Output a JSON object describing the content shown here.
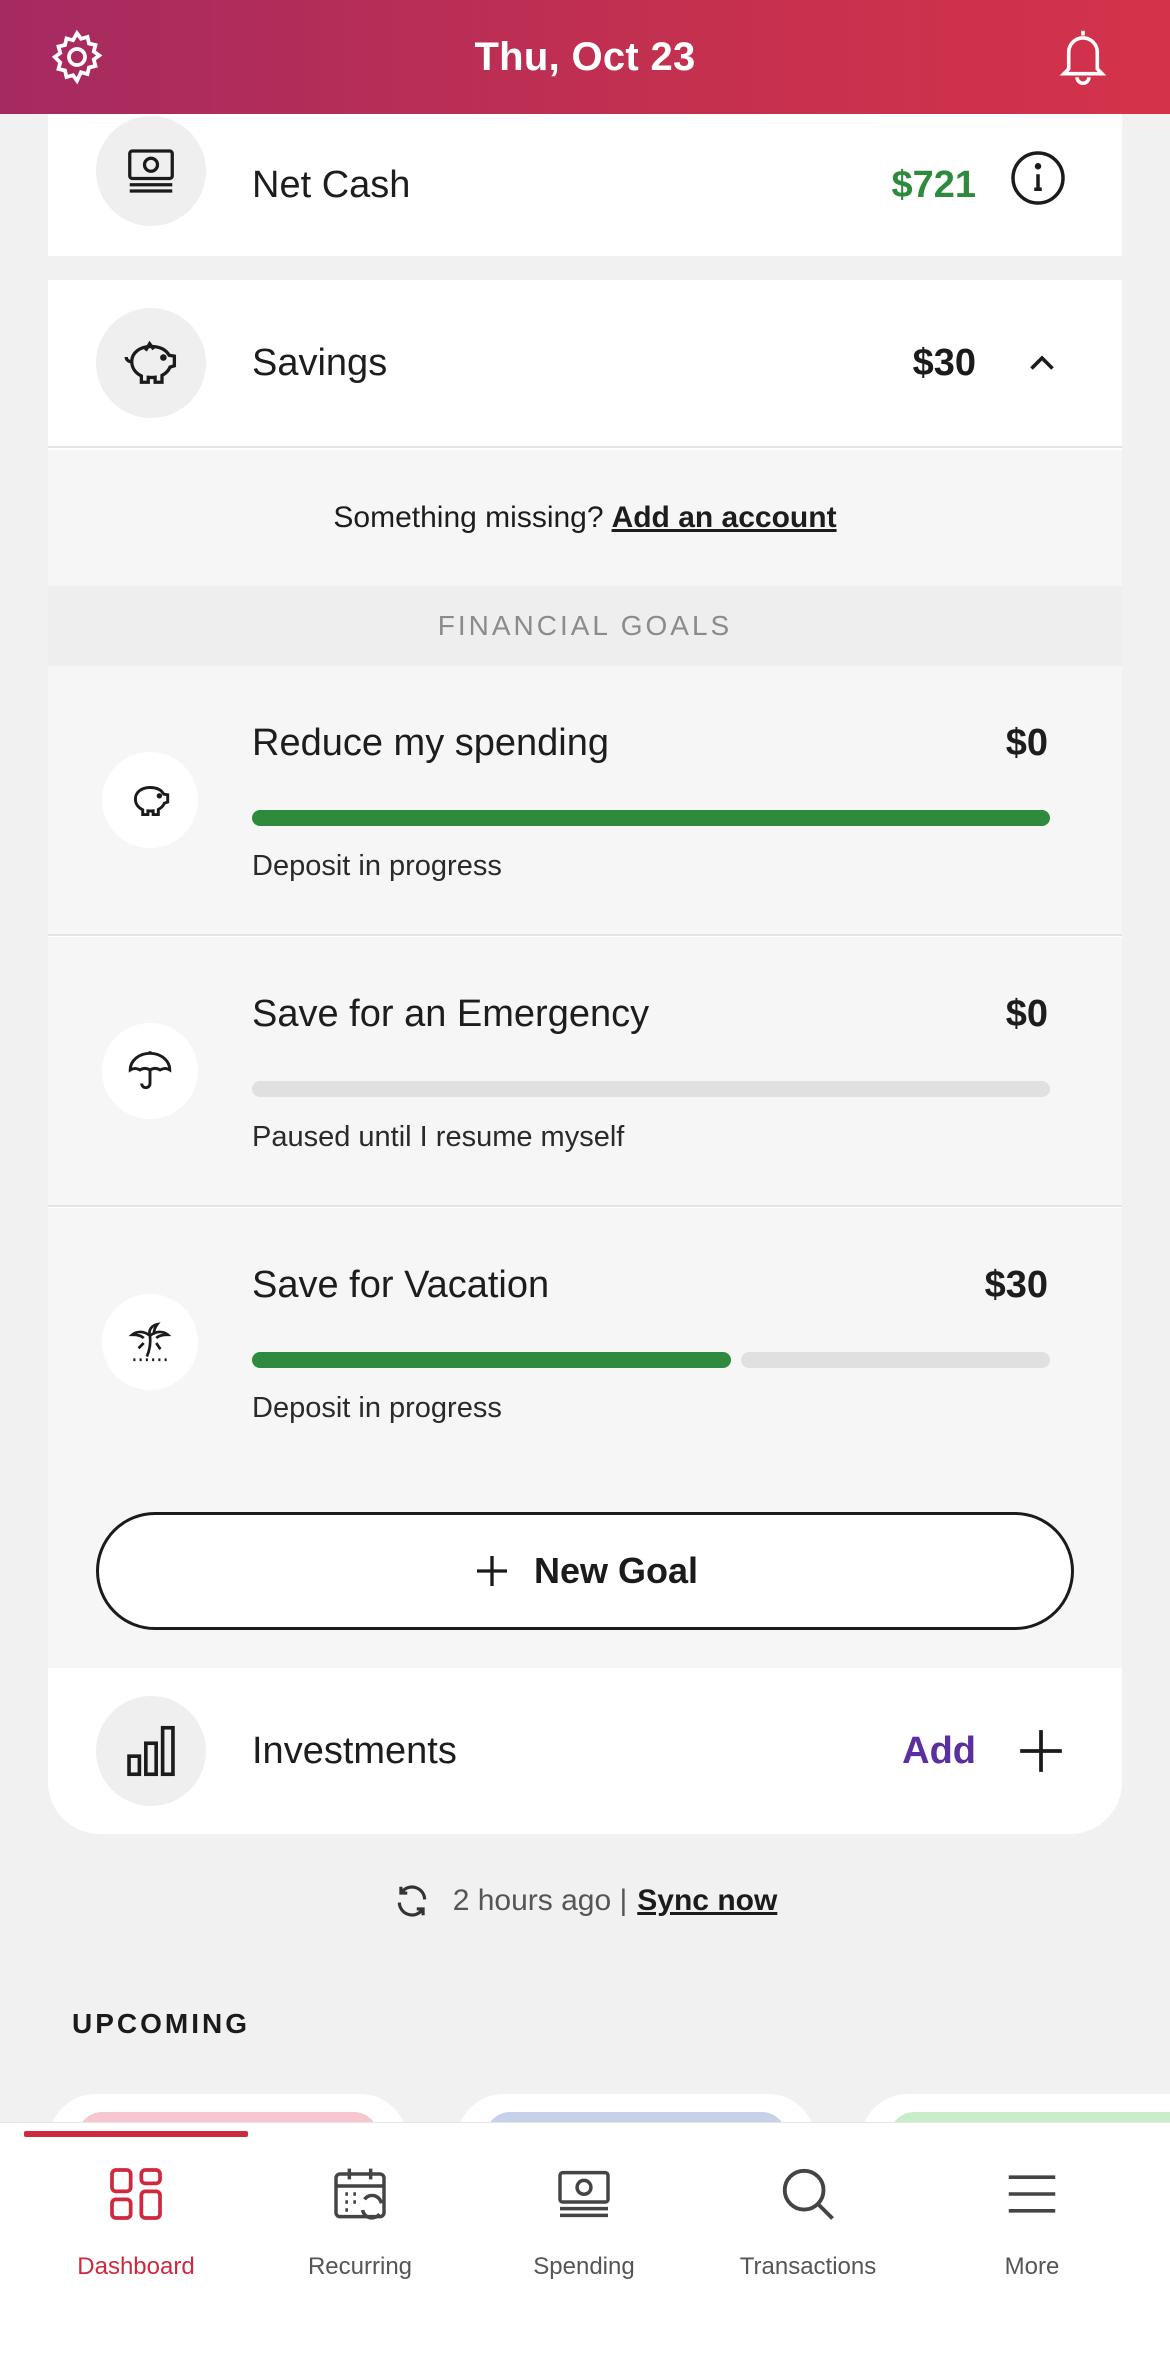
{
  "header": {
    "date": "Thu, Oct 23",
    "settings_icon": "gear-icon",
    "notifications_icon": "bell-icon"
  },
  "accounts": {
    "net_cash": {
      "label": "Net Cash",
      "value": "$721",
      "icon": "cash-icon",
      "info_icon": "info-icon"
    },
    "savings": {
      "label": "Savings",
      "value": "$30",
      "icon": "piggy-bank-icon",
      "toggle_icon": "chevron-up-icon"
    },
    "missing": {
      "prompt": "Something missing?",
      "link": "Add an account"
    }
  },
  "financial_goals": {
    "heading": "FINANCIAL GOALS",
    "goals": [
      {
        "title": "Reduce my spending",
        "amount": "$0",
        "status": "Deposit in progress",
        "progress": 1.0,
        "icon": "piggy-bank-icon"
      },
      {
        "title": "Save for an Emergency",
        "amount": "$0",
        "status": "Paused until I resume myself",
        "progress": 0.0,
        "icon": "umbrella-icon"
      },
      {
        "title": "Save for Vacation",
        "amount": "$30",
        "status": "Deposit in progress",
        "progress": 0.6,
        "icon": "palm-tree-icon"
      }
    ],
    "new_goal_label": "New Goal"
  },
  "investments": {
    "label": "Investments",
    "action": "Add",
    "icon": "bar-chart-icon"
  },
  "sync": {
    "time": "2 hours ago |",
    "link": "Sync now"
  },
  "upcoming": {
    "heading": "UPCOMING"
  },
  "colors": {
    "brand": "#c5304f",
    "positive": "#2e8b3e",
    "accent_purple": "#5b2fa0",
    "nav_active": "#d0293f"
  },
  "nav": {
    "items": [
      {
        "label": "Dashboard",
        "icon": "dashboard-icon",
        "active": true
      },
      {
        "label": "Recurring",
        "icon": "calendar-icon",
        "active": false
      },
      {
        "label": "Spending",
        "icon": "cash-icon",
        "active": false
      },
      {
        "label": "Transactions",
        "icon": "search-icon",
        "active": false
      },
      {
        "label": "More",
        "icon": "menu-icon",
        "active": false
      }
    ]
  }
}
